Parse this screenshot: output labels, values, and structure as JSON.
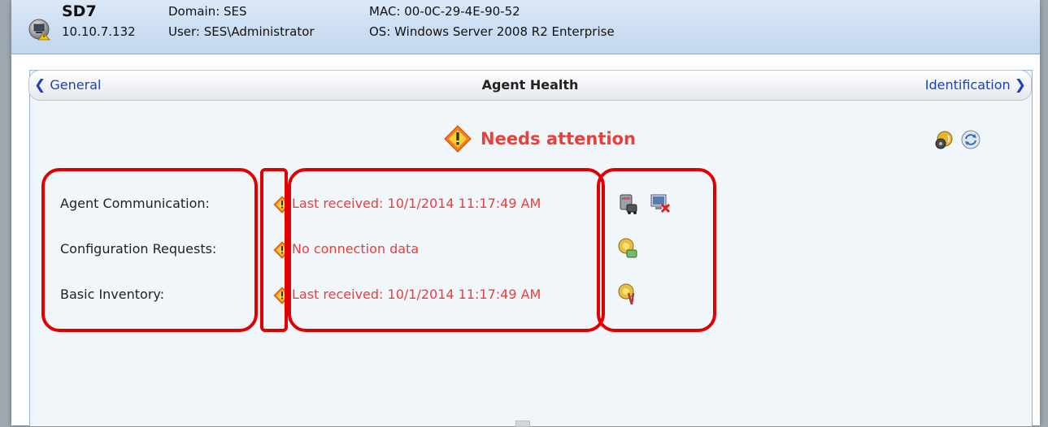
{
  "header": {
    "name": "SD7",
    "ip": "10.10.7.132",
    "domain": "Domain: SES",
    "user": "User: SES\\Administrator",
    "mac": "MAC: 00-0C-29-4E-90-52",
    "os": "OS: Windows Server 2008 R2 Enterprise"
  },
  "nav": {
    "prev": "General",
    "title": "Agent Health",
    "next": "Identification"
  },
  "status": {
    "text": "Needs attention",
    "color": "#e8403b"
  },
  "rows": [
    {
      "label": "Agent Communication:",
      "value": "Last received: 10/1/2014 11:17:49 AM"
    },
    {
      "label": "Configuration Requests:",
      "value": "No connection data"
    },
    {
      "label": "Basic Inventory:",
      "value": "Last received: 10/1/2014 11:17:49 AM"
    }
  ],
  "icons": {
    "computer": "computer-status-icon",
    "warning": "warning-diamond-icon",
    "settings": "agent-settings-icon",
    "refresh": "refresh-icon"
  },
  "highlight_color": "#e00000"
}
